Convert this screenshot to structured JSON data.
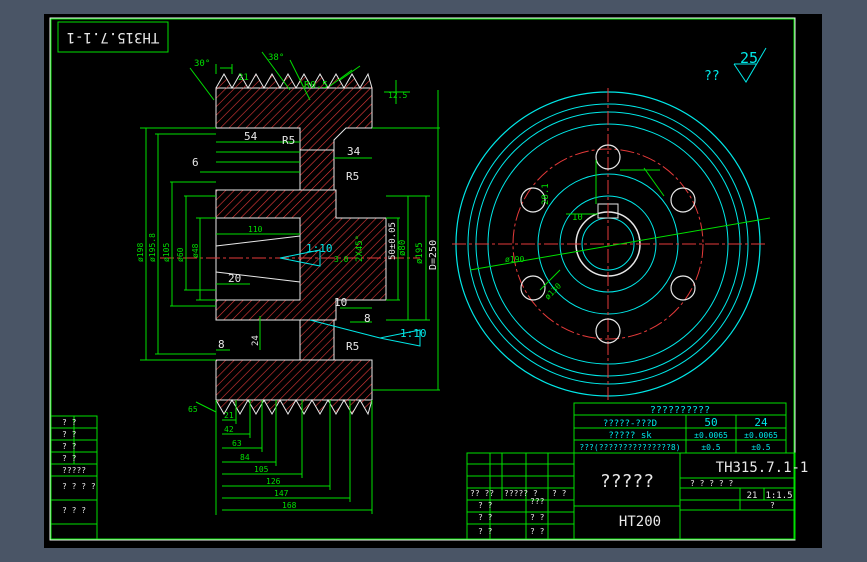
{
  "drawing": {
    "code_rotated": "TH315.7.1-1",
    "roughness_note": "??",
    "roughness_value": "25",
    "material": "HT200",
    "part_name": "?????",
    "drawing_code": "TH315.7.1-1",
    "scale_note": "21",
    "scale": "1:1.5"
  },
  "gear_table": {
    "title": "??????????",
    "rows": [
      {
        "label": "?????-???D",
        "c1": "50",
        "c2": "24"
      },
      {
        "label": "????? sk",
        "c1": "±0.0065",
        "c2": "±0.0065"
      },
      {
        "label": "???(???????????????8)",
        "c1": "±0.5",
        "c2": "±0.5"
      }
    ]
  },
  "left_table_labels": [
    "? ?",
    "? ?",
    "? ?",
    "? ?",
    "?????",
    "? ? ? ?",
    "? ? ?"
  ],
  "title_block_labels": [
    "?? ??",
    "????? ?",
    "? ?",
    "? ?",
    "? ?",
    "???",
    "? ?",
    "? ?",
    "? ?",
    "? ? ? ? ?",
    "?"
  ],
  "dimensions": {
    "top_angle": "30°",
    "pitch": "21",
    "groove_angle": "38°",
    "radius_top": "R0.5",
    "width_54": "54",
    "r5_a": "R5",
    "dim_6": "6",
    "dim_34": "34",
    "r5_b": "R5",
    "dim_20": "20",
    "dim_10": "10",
    "dim_8a": "8",
    "dim_8b": "8",
    "r5_c": "R5",
    "taper_a": "1:10",
    "taper_b": "1:10",
    "chamfer": "2X45°",
    "dim_3": "3.0",
    "d_250": "D=250",
    "d_195": "ø195",
    "d_50": "50±0.05",
    "d_198": "ø198",
    "d_195b": "ø195.8",
    "d_105": "ø105",
    "d_60": "ø60",
    "d_48": "ø48",
    "dim_24": "24",
    "dim_110": "110",
    "d_80": "ø80",
    "d_130": "ø130",
    "d_28": "28.1",
    "d_10": "10",
    "d_190": "ø190",
    "dim_12_5": "12.5",
    "dim_65": "65",
    "dims_bottom": [
      "21",
      "42",
      "63",
      "84",
      "105",
      "126",
      "147",
      "168"
    ]
  }
}
